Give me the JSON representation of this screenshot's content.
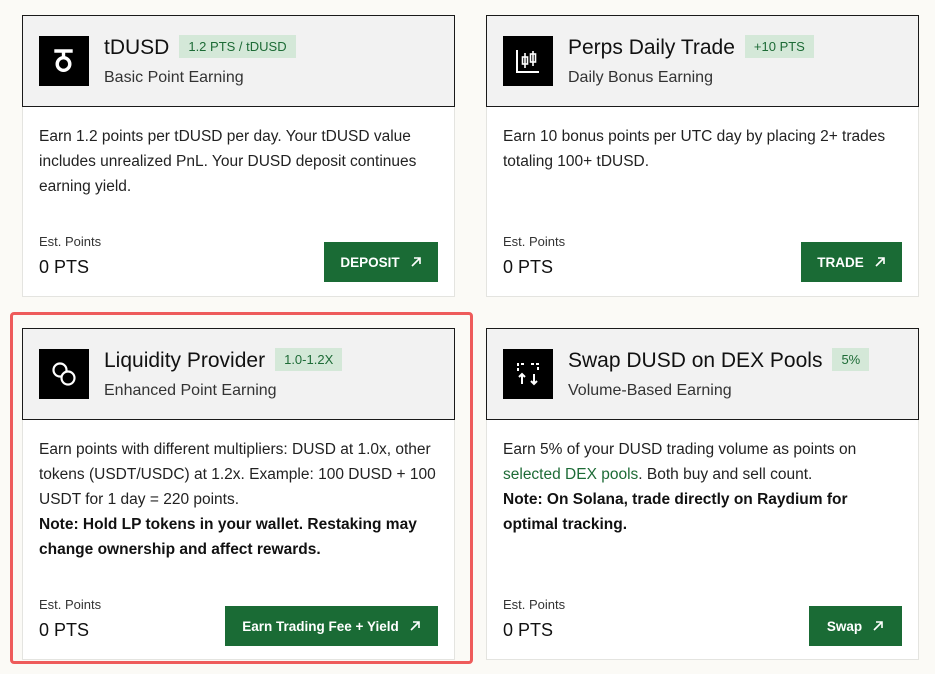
{
  "cards": [
    {
      "title": "tDUSD",
      "badge": "1.2 PTS / tDUSD",
      "subtitle": "Basic Point Earning",
      "description": "Earn 1.2 points per tDUSD per day. Your tDUSD value includes unrealized PnL. Your DUSD deposit continues earning yield.",
      "est_label": "Est. Points",
      "est_value": "0 PTS",
      "button_label": "DEPOSIT",
      "icon": "tdusd-logo-icon"
    },
    {
      "title": "Perps Daily Trade",
      "badge": "+10 PTS",
      "subtitle": "Daily Bonus Earning",
      "description": "Earn 10 bonus points per UTC day by placing 2+ trades totaling 100+ tDUSD.",
      "est_label": "Est. Points",
      "est_value": "0 PTS",
      "button_label": "TRADE",
      "icon": "candlestick-chart-icon"
    },
    {
      "title": "Liquidity Provider",
      "badge": "1.0-1.2X",
      "subtitle": "Enhanced Point Earning",
      "description": "Earn points with different multipliers: DUSD at 1.0x, other tokens (USDT/USDC) at 1.2x. Example: 100 DUSD + 100 USDT for 1 day = 220 points.",
      "note": "Note: Hold LP tokens in your wallet. Restaking may change ownership and affect rewards.",
      "est_label": "Est. Points",
      "est_value": "0 PTS",
      "button_label": "Earn Trading Fee + Yield",
      "icon": "coins-icon"
    },
    {
      "title": "Swap DUSD on DEX Pools",
      "badge": "5%",
      "subtitle": "Volume-Based Earning",
      "description_pre": "Earn 5% of your DUSD trading volume as points on",
      "description_link": "selected DEX pools",
      "description_post": ". Both buy and sell count.",
      "note": "Note: On Solana, trade directly on Raydium for optimal tracking.",
      "est_label": "Est. Points",
      "est_value": "0 PTS",
      "button_label": "Swap",
      "icon": "swap-arrows-icon"
    }
  ],
  "colors": {
    "accent_green": "#1a6b35",
    "badge_bg": "#d4e8d8",
    "highlight_red": "#ee5b5b"
  }
}
